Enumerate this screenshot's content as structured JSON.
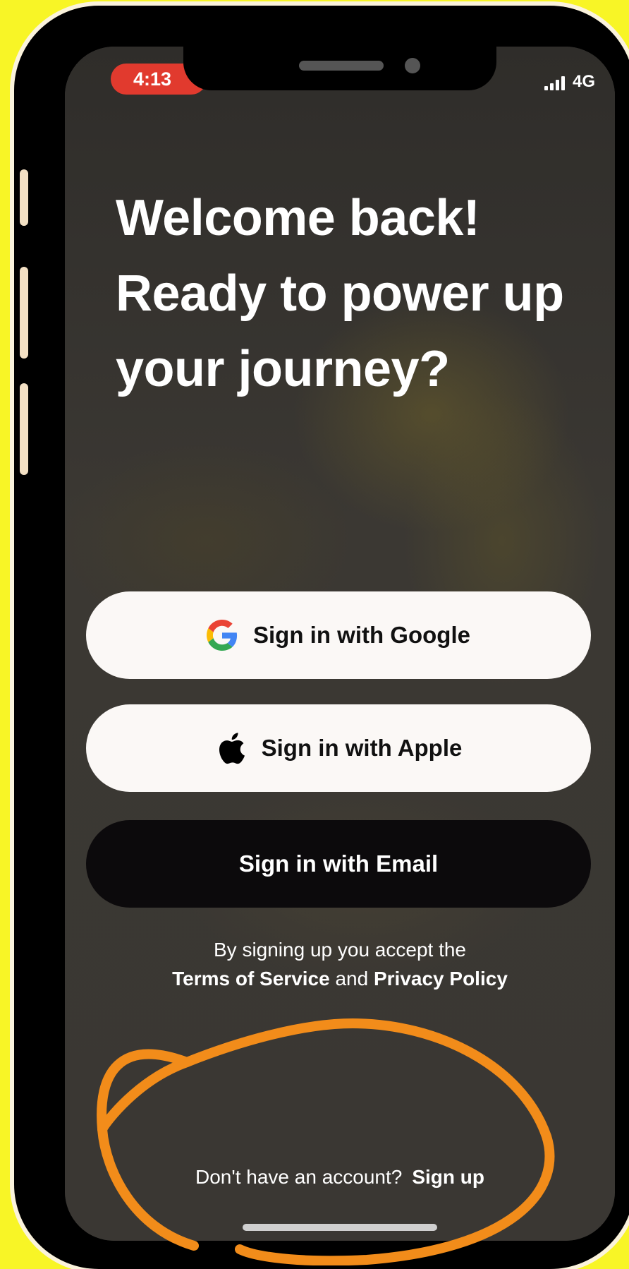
{
  "status_bar": {
    "time": "4:13",
    "network": "4G",
    "signal_icon": "signal-bars-icon",
    "battery_icon": "battery-icon"
  },
  "headline": "Welcome back! Ready to power up your journey?",
  "buttons": {
    "google": {
      "label": "Sign in with Google",
      "icon": "google-icon"
    },
    "apple": {
      "label": "Sign in with Apple",
      "icon": "apple-icon"
    },
    "email": {
      "label": "Sign in with Email"
    }
  },
  "legal": {
    "line1": "By signing up you accept the",
    "terms": "Terms of Service",
    "conjunction": "and",
    "privacy": "Privacy Policy"
  },
  "signup": {
    "prompt": "Don't have an account?",
    "link": "Sign up"
  },
  "colors": {
    "page_background": "#f8f526",
    "annotation": "#f28c1a",
    "time_pill": "#e13a2e",
    "email_button": "#0c0a0c",
    "light_button": "#fbf8f6"
  }
}
